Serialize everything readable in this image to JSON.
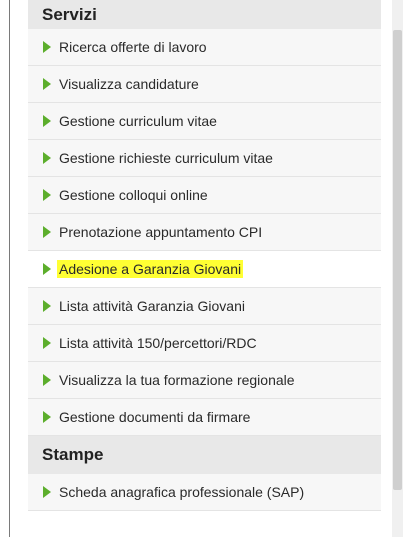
{
  "sections": {
    "servizi": {
      "title": "Servizi",
      "items": [
        {
          "label": "Ricerca offerte di lavoro"
        },
        {
          "label": "Visualizza candidature"
        },
        {
          "label": "Gestione curriculum vitae"
        },
        {
          "label": "Gestione richieste curriculum vitae"
        },
        {
          "label": "Gestione colloqui online"
        },
        {
          "label": "Prenotazione appuntamento CPI"
        },
        {
          "label": "Adesione a Garanzia Giovani"
        },
        {
          "label": "Lista attività Garanzia Giovani"
        },
        {
          "label": "Lista attività 150/percettori/RDC"
        },
        {
          "label": "Visualizza la tua formazione regionale"
        },
        {
          "label": "Gestione documenti da firmare"
        }
      ]
    },
    "stampe": {
      "title": "Stampe",
      "items": [
        {
          "label": "Scheda anagrafica professionale (SAP)"
        }
      ]
    }
  },
  "colors": {
    "arrow": "#5cae2c",
    "highlight": "#ffff33",
    "header_bg": "#e8e8e8"
  },
  "icons": {
    "bullet": "green-triangle-arrow-icon"
  }
}
